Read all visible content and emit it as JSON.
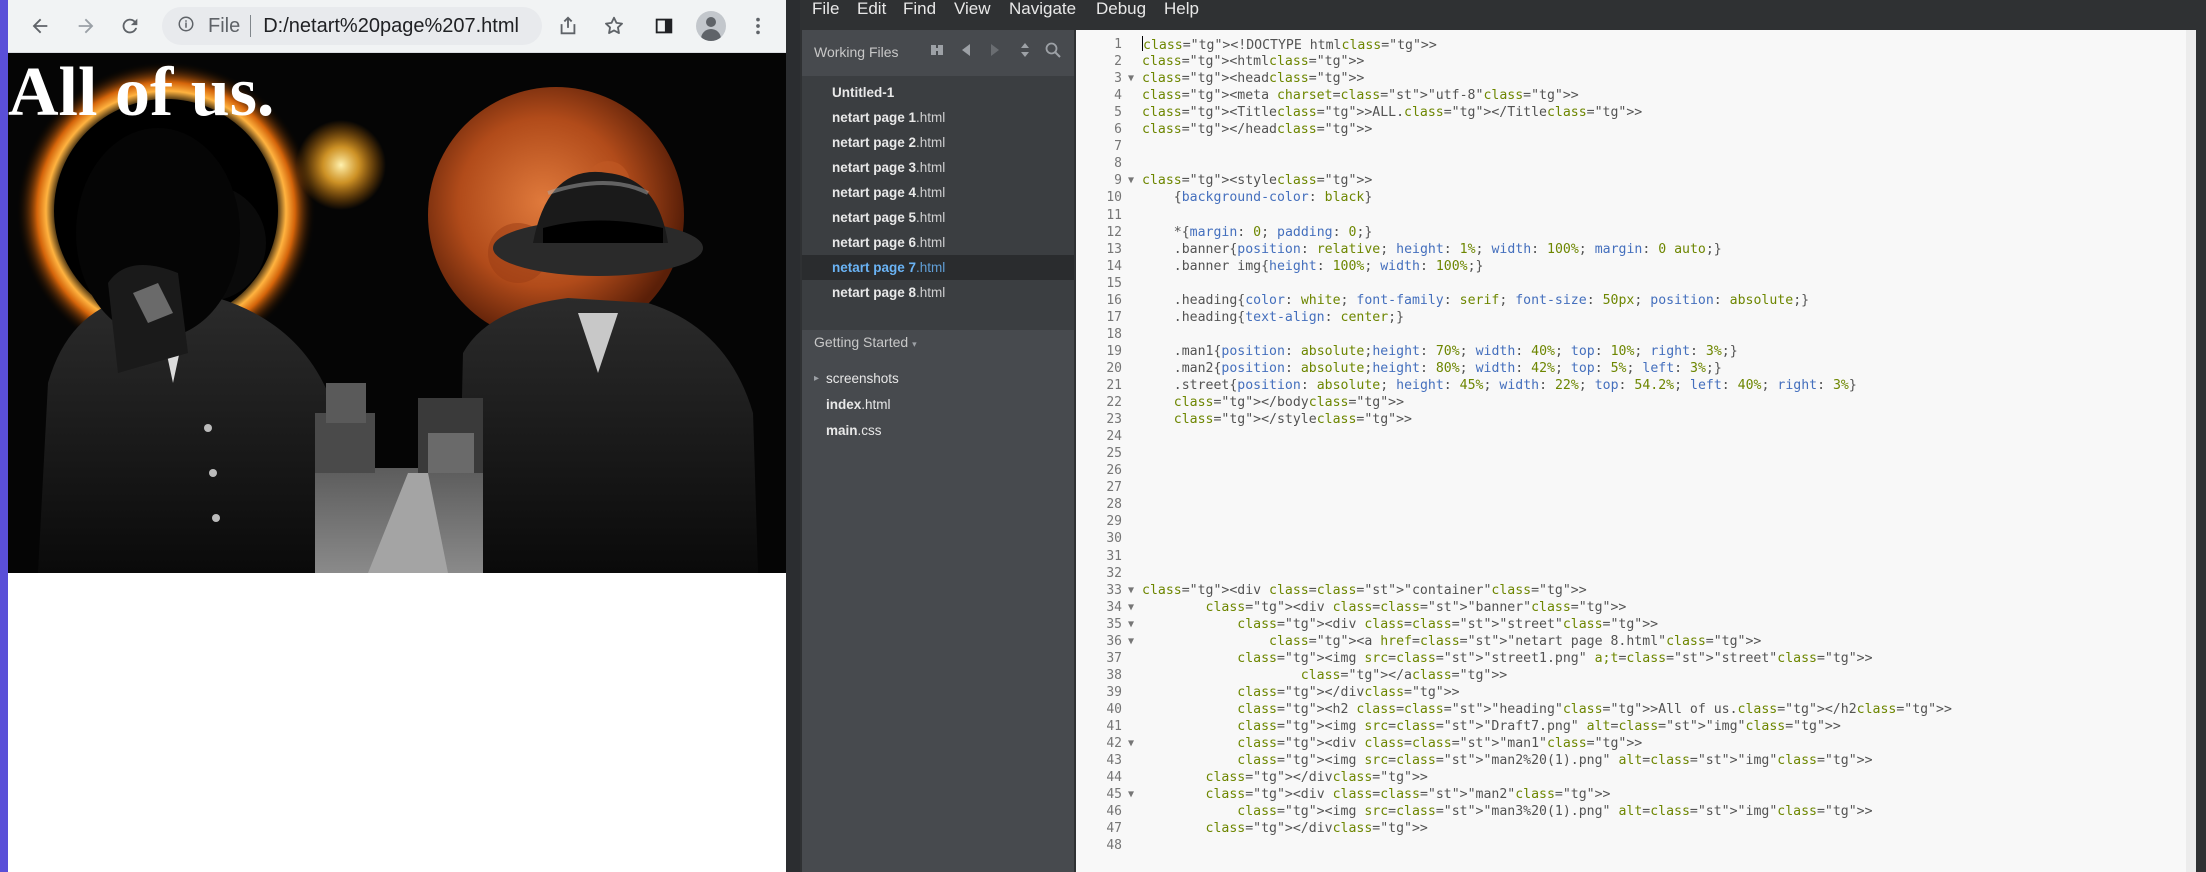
{
  "browser": {
    "address": {
      "scheme_label": "File",
      "url": "D:/netart%20page%207.html"
    },
    "page": {
      "heading": "All of us."
    }
  },
  "editor": {
    "menu": [
      "File",
      "Edit",
      "Find",
      "View",
      "Navigate",
      "Debug",
      "Help"
    ],
    "sidebar": {
      "working_files_title": "Working Files",
      "working_files": [
        {
          "name": "Untitled-1",
          "ext": ""
        },
        {
          "name": "netart page 1",
          "ext": ".html"
        },
        {
          "name": "netart page 2",
          "ext": ".html"
        },
        {
          "name": "netart page 3",
          "ext": ".html"
        },
        {
          "name": "netart page 4",
          "ext": ".html"
        },
        {
          "name": "netart page 5",
          "ext": ".html"
        },
        {
          "name": "netart page 6",
          "ext": ".html"
        },
        {
          "name": "netart page 7",
          "ext": ".html"
        },
        {
          "name": "netart page 8",
          "ext": ".html"
        }
      ],
      "active_index": 7,
      "project_title": "Getting Started",
      "tree": [
        {
          "name": "screenshots",
          "ext": "",
          "folder": true
        },
        {
          "name": "index",
          "ext": ".html",
          "folder": false
        },
        {
          "name": "main",
          "ext": ".css",
          "folder": false
        }
      ]
    },
    "code_lines": [
      "<!DOCTYPE html>",
      "<html>",
      "<head>",
      "<meta charset=\"utf-8\">",
      "<Title>ALL.</Title>",
      "</head>",
      "",
      "",
      "<style>",
      "    {background-color: black}",
      "",
      "    *{margin: 0; padding: 0;}",
      "    .banner{position: relative; height: 1%; width:100%; margin: 0 auto;}",
      "    .banner img{height: 100%; width: 100%;}",
      "",
      "    .heading{color: white; font-family: serif; font-size: 50px; position: absolute;}",
      "    .heading{text-align: center;}",
      "",
      "    .man1{position: absolute;height: 70%; width: 40%; top: 10%; right: 3%;}",
      "    .man2{position: absolute;height: 80%; width: 42%; top: 5%; left: 3%;}",
      "    .street{position: absolute; height: 45%; width: 22%; top:54.2%; left: 40%; right: 3%}",
      "    </body>",
      "    </style>",
      "",
      "",
      "",
      "",
      "",
      "",
      "",
      "",
      "",
      "<div class=\"container\">",
      "        <div class=\"banner\">",
      "            <div class=\"street\">",
      "                <a href=\"netart page 8.html\">",
      "            <img src=\"street1.png\" a;t=\"street\">",
      "                    </a>",
      "            </div>",
      "            <h2 class=\"heading\">All of us.</h2>",
      "            <img src=\"Draft7.png\" alt=\"img\">",
      "            <div class=\"man1\">",
      "            <img src=\"man2%20(1).png\" alt=\"img\">",
      "        </div>",
      "        <div class=\"man2\">",
      "            <img src=\"man3%20(1).png\" alt=\"img\">",
      "        </div>",
      ""
    ]
  }
}
